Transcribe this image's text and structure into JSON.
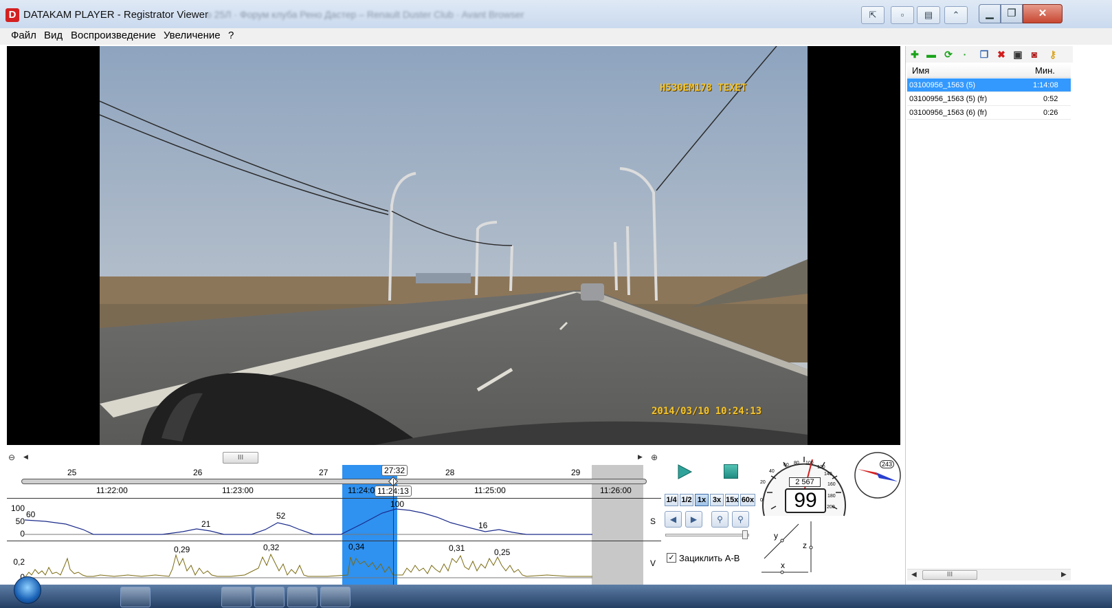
{
  "window": {
    "title": "DATAKAM PLAYER - Registrator Viewer",
    "blurred_tabs": "о 25Л · Форум клуба Рено Дастер – Renault Duster Club · Avant Browser",
    "icon_letter": "D",
    "controls": {
      "minimize": "▁",
      "maximize": "❐",
      "close": "✕"
    },
    "extra_buttons": [
      "⇱",
      "▫",
      "▤",
      "⌃"
    ]
  },
  "menu": {
    "items": [
      "Файл",
      "Вид",
      "Воспроизведение",
      "Увеличение",
      "?"
    ]
  },
  "video": {
    "osd_plate": "Н530ЕМ178  ТЕХЕТ",
    "osd_datetime": "2014/03/10 10:24:13"
  },
  "files": {
    "toolbar_icons": [
      "add-icon",
      "remove-icon",
      "refresh-icon",
      "dot-icon",
      "copy-icon",
      "delete-icon",
      "save-icon",
      "snapshot-icon",
      "key-icon"
    ],
    "header_name": "Имя",
    "header_duration": "Мин.",
    "rows": [
      {
        "name": "03100956_1563 (5)",
        "duration": "1:14:08"
      },
      {
        "name": "03100956_1563 (5) (fr)",
        "duration": "0:52"
      },
      {
        "name": "03100956_1563 (6) (fr)",
        "duration": "0:26"
      }
    ],
    "selected_index": 0
  },
  "timeline": {
    "minute_ticks": [
      "25",
      "26",
      "27",
      "28",
      "29"
    ],
    "cursor_minute": "27:32",
    "time_ticks": [
      "11:22:00",
      "11:23:00",
      "11:24:00",
      "11:25:00",
      "11:26:00"
    ],
    "cursor_time": "11:24:13",
    "scroll_thumb": "III",
    "speed_chart": {
      "series_label": "S",
      "y_ticks": [
        "100",
        "50",
        "0"
      ],
      "peaks": [
        "60",
        "21",
        "52",
        "100",
        "16"
      ]
    },
    "accel_chart": {
      "series_label": "V",
      "y_ticks": [
        "0,2",
        "0"
      ],
      "peaks": [
        "0,29",
        "0,32",
        "0,34",
        "0,31",
        "0,25"
      ]
    }
  },
  "controls": {
    "speeds": [
      "1/4",
      "1/2",
      "1x",
      "3x",
      "15x",
      "60x"
    ],
    "active_speed": "1x",
    "loop_label": "Зациклить А-В",
    "loop_checked": "✓",
    "speedometer": {
      "value": "99",
      "odometer": "2 567",
      "scale": [
        "0",
        "20",
        "40",
        "60",
        "80",
        "100",
        "120",
        "140",
        "160",
        "180",
        "200"
      ]
    },
    "compass": {
      "heading": "243"
    },
    "axes": {
      "x": "x",
      "y": "y",
      "z": "z"
    }
  },
  "right_scroll": {
    "thumb": "III"
  },
  "colors": {
    "selection": "#2f91f0",
    "speed_line": "#1a2a8a",
    "accel_line": "#7a6a10",
    "osd": "#f2c531"
  }
}
